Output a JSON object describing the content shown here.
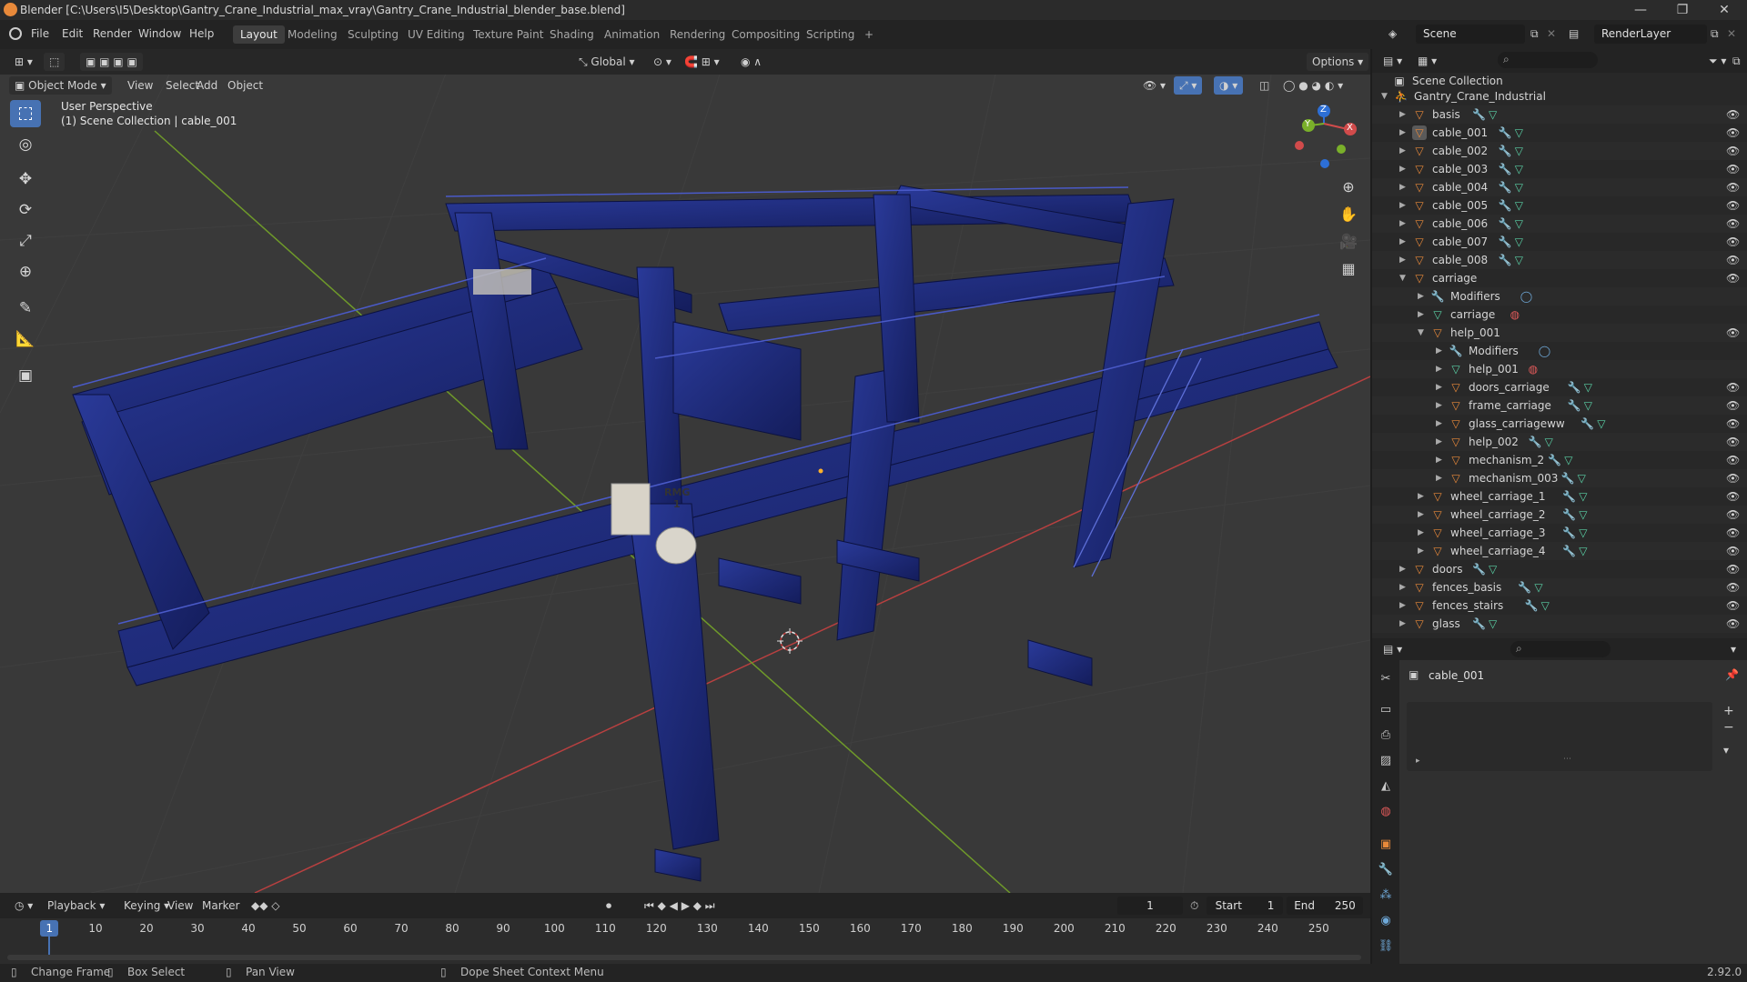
{
  "window": {
    "title": "Blender [C:\\Users\\I5\\Desktop\\Gantry_Crane_Industrial_max_vray\\Gantry_Crane_Industrial_blender_base.blend]",
    "controls": {
      "minimize": "—",
      "maximize": "❐",
      "close": "✕"
    }
  },
  "menu": {
    "items": [
      "File",
      "Edit",
      "Render",
      "Window",
      "Help"
    ]
  },
  "workspaces": [
    "Layout",
    "Modeling",
    "Sculpting",
    "UV Editing",
    "Texture Paint",
    "Shading",
    "Animation",
    "Rendering",
    "Compositing",
    "Scripting",
    "+"
  ],
  "scene": {
    "name": "Scene",
    "view_layer": "RenderLayer"
  },
  "toolrow": {
    "transform_orientation": "Global",
    "options": "Options"
  },
  "viewport_header": {
    "mode": "Object Mode",
    "menus": [
      "View",
      "Select",
      "Add",
      "Object"
    ]
  },
  "viewport": {
    "perspective": "User Perspective",
    "collection_info": "(1) Scene Collection | cable_001",
    "signs": {
      "rmg": "RMG",
      "rmg_num": "1"
    },
    "gizmo": {
      "x": "X",
      "y": "Y",
      "z": "Z"
    }
  },
  "outliner": {
    "root": "Scene Collection",
    "rows": [
      {
        "label": "Gantry_Crane_Industrial",
        "indent": 0,
        "expanded": true,
        "icon": "person",
        "mod": false,
        "mesh": false,
        "eye": false
      },
      {
        "label": "basis",
        "indent": 1,
        "expanded": false,
        "icon": "object",
        "mod": true,
        "mesh": true,
        "eye": true
      },
      {
        "label": "cable_001",
        "indent": 1,
        "expanded": false,
        "icon": "object",
        "mod": true,
        "mesh": true,
        "eye": true,
        "active": true
      },
      {
        "label": "cable_002",
        "indent": 1,
        "expanded": false,
        "icon": "object",
        "mod": true,
        "mesh": true,
        "eye": true
      },
      {
        "label": "cable_003",
        "indent": 1,
        "expanded": false,
        "icon": "object",
        "mod": true,
        "mesh": true,
        "eye": true
      },
      {
        "label": "cable_004",
        "indent": 1,
        "expanded": false,
        "icon": "object",
        "mod": true,
        "mesh": true,
        "eye": true
      },
      {
        "label": "cable_005",
        "indent": 1,
        "expanded": false,
        "icon": "object",
        "mod": true,
        "mesh": true,
        "eye": true
      },
      {
        "label": "cable_006",
        "indent": 1,
        "expanded": false,
        "icon": "object",
        "mod": true,
        "mesh": true,
        "eye": true
      },
      {
        "label": "cable_007",
        "indent": 1,
        "expanded": false,
        "icon": "object",
        "mod": true,
        "mesh": true,
        "eye": true
      },
      {
        "label": "cable_008",
        "indent": 1,
        "expanded": false,
        "icon": "object",
        "mod": true,
        "mesh": true,
        "eye": true
      },
      {
        "label": "carriage",
        "indent": 1,
        "expanded": true,
        "icon": "object",
        "mod": false,
        "mesh": false,
        "eye": true
      },
      {
        "label": "Modifiers",
        "indent": 2,
        "expanded": false,
        "icon": "wrench",
        "mod": false,
        "mesh": false,
        "eye": false,
        "extra": "modifier"
      },
      {
        "label": "carriage",
        "indent": 2,
        "expanded": false,
        "icon": "mesh",
        "mod": false,
        "mesh": false,
        "eye": false,
        "extra": "material"
      },
      {
        "label": "help_001",
        "indent": 2,
        "expanded": true,
        "icon": "object",
        "mod": false,
        "mesh": false,
        "eye": true
      },
      {
        "label": "Modifiers",
        "indent": 3,
        "expanded": false,
        "icon": "wrench",
        "mod": false,
        "mesh": false,
        "eye": false,
        "extra": "modifier"
      },
      {
        "label": "help_001",
        "indent": 3,
        "expanded": false,
        "icon": "mesh",
        "mod": false,
        "mesh": false,
        "eye": false,
        "extra": "material"
      },
      {
        "label": "doors_carriage",
        "indent": 3,
        "expanded": false,
        "icon": "object",
        "mod": true,
        "mesh": true,
        "eye": true
      },
      {
        "label": "frame_carriage",
        "indent": 3,
        "expanded": false,
        "icon": "object",
        "mod": true,
        "mesh": true,
        "eye": true
      },
      {
        "label": "glass_carriageww",
        "indent": 3,
        "expanded": false,
        "icon": "object",
        "mod": true,
        "mesh": true,
        "eye": true
      },
      {
        "label": "help_002",
        "indent": 3,
        "expanded": false,
        "icon": "object",
        "mod": true,
        "mesh": true,
        "eye": true
      },
      {
        "label": "mechanism_2",
        "indent": 3,
        "expanded": false,
        "icon": "object",
        "mod": true,
        "mesh": true,
        "eye": true
      },
      {
        "label": "mechanism_003",
        "indent": 3,
        "expanded": false,
        "icon": "object",
        "mod": true,
        "mesh": true,
        "eye": true
      },
      {
        "label": "wheel_carriage_1",
        "indent": 2,
        "expanded": false,
        "icon": "object",
        "mod": true,
        "mesh": true,
        "eye": true
      },
      {
        "label": "wheel_carriage_2",
        "indent": 2,
        "expanded": false,
        "icon": "object",
        "mod": true,
        "mesh": true,
        "eye": true
      },
      {
        "label": "wheel_carriage_3",
        "indent": 2,
        "expanded": false,
        "icon": "object",
        "mod": true,
        "mesh": true,
        "eye": true
      },
      {
        "label": "wheel_carriage_4",
        "indent": 2,
        "expanded": false,
        "icon": "object",
        "mod": true,
        "mesh": true,
        "eye": true
      },
      {
        "label": "doors",
        "indent": 1,
        "expanded": false,
        "icon": "object",
        "mod": true,
        "mesh": true,
        "eye": true
      },
      {
        "label": "fences_basis",
        "indent": 1,
        "expanded": false,
        "icon": "object",
        "mod": true,
        "mesh": true,
        "eye": true
      },
      {
        "label": "fences_stairs",
        "indent": 1,
        "expanded": false,
        "icon": "object",
        "mod": true,
        "mesh": true,
        "eye": true
      },
      {
        "label": "glass",
        "indent": 1,
        "expanded": false,
        "icon": "object",
        "mod": true,
        "mesh": true,
        "eye": true
      }
    ]
  },
  "properties": {
    "object_name": "cable_001",
    "plus": "+",
    "minus": "−"
  },
  "timeline": {
    "menus": [
      "Playback",
      "Keying",
      "View",
      "Marker"
    ],
    "current_frame": "1",
    "start_label": "Start",
    "start": "1",
    "end_label": "End",
    "end": "250",
    "ruler": [
      "1",
      "10",
      "20",
      "30",
      "40",
      "50",
      "60",
      "70",
      "80",
      "90",
      "100",
      "110",
      "120",
      "130",
      "140",
      "150",
      "160",
      "170",
      "180",
      "190",
      "200",
      "210",
      "220",
      "230",
      "240",
      "250"
    ]
  },
  "status": {
    "change_frame": "Change Frame",
    "box_select": "Box Select",
    "pan_view": "Pan View",
    "context_menu": "Dope Sheet Context Menu",
    "version": "2.92.0"
  },
  "colors": {
    "accent": "#4772b3",
    "object": "#e8893a",
    "mesh": "#5ad1a6",
    "crane": "#1c2a78"
  }
}
